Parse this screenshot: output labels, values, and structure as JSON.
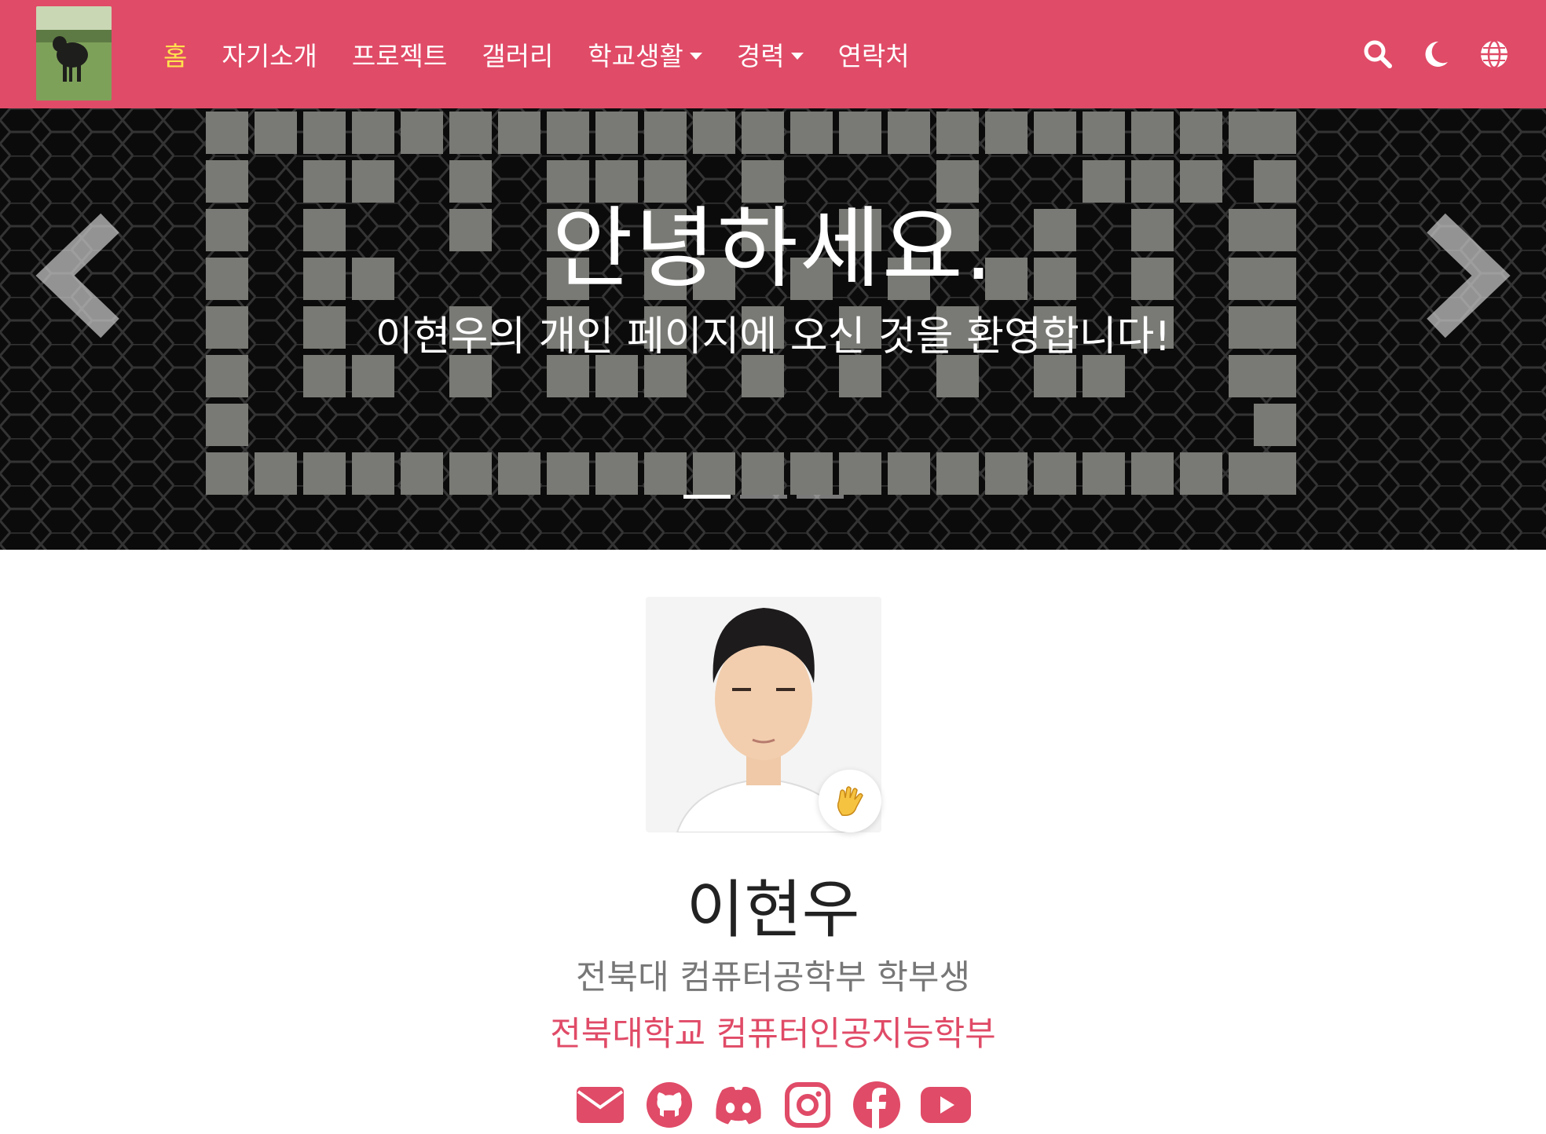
{
  "nav": {
    "items": [
      {
        "label": "홈",
        "active": true,
        "dropdown": false
      },
      {
        "label": "자기소개",
        "active": false,
        "dropdown": false
      },
      {
        "label": "프로젝트",
        "active": false,
        "dropdown": false
      },
      {
        "label": "갤러리",
        "active": false,
        "dropdown": false
      },
      {
        "label": "학교생활",
        "active": false,
        "dropdown": true
      },
      {
        "label": "경력",
        "active": false,
        "dropdown": true
      },
      {
        "label": "연락처",
        "active": false,
        "dropdown": false
      }
    ],
    "icons": [
      "search-icon",
      "moon-icon",
      "globe-icon"
    ]
  },
  "hero": {
    "title": "안녕하세요.",
    "subtitle": "이현우의 개인 페이지에 오신 것을 환영합니다!",
    "slide_count": 3,
    "active_slide": 1
  },
  "profile": {
    "name": "이현우",
    "role": "전북대 컴퓨터공학부 학부생",
    "organization": "전북대학교 컴퓨터인공지능학부",
    "badge_icon": "waving-hand-icon"
  },
  "social": [
    "email-icon",
    "github-icon",
    "discord-icon",
    "instagram-icon",
    "facebook-icon",
    "youtube-icon"
  ],
  "colors": {
    "primary": "#e04b67",
    "active_nav": "#ffe34d",
    "muted_text": "#777777"
  }
}
